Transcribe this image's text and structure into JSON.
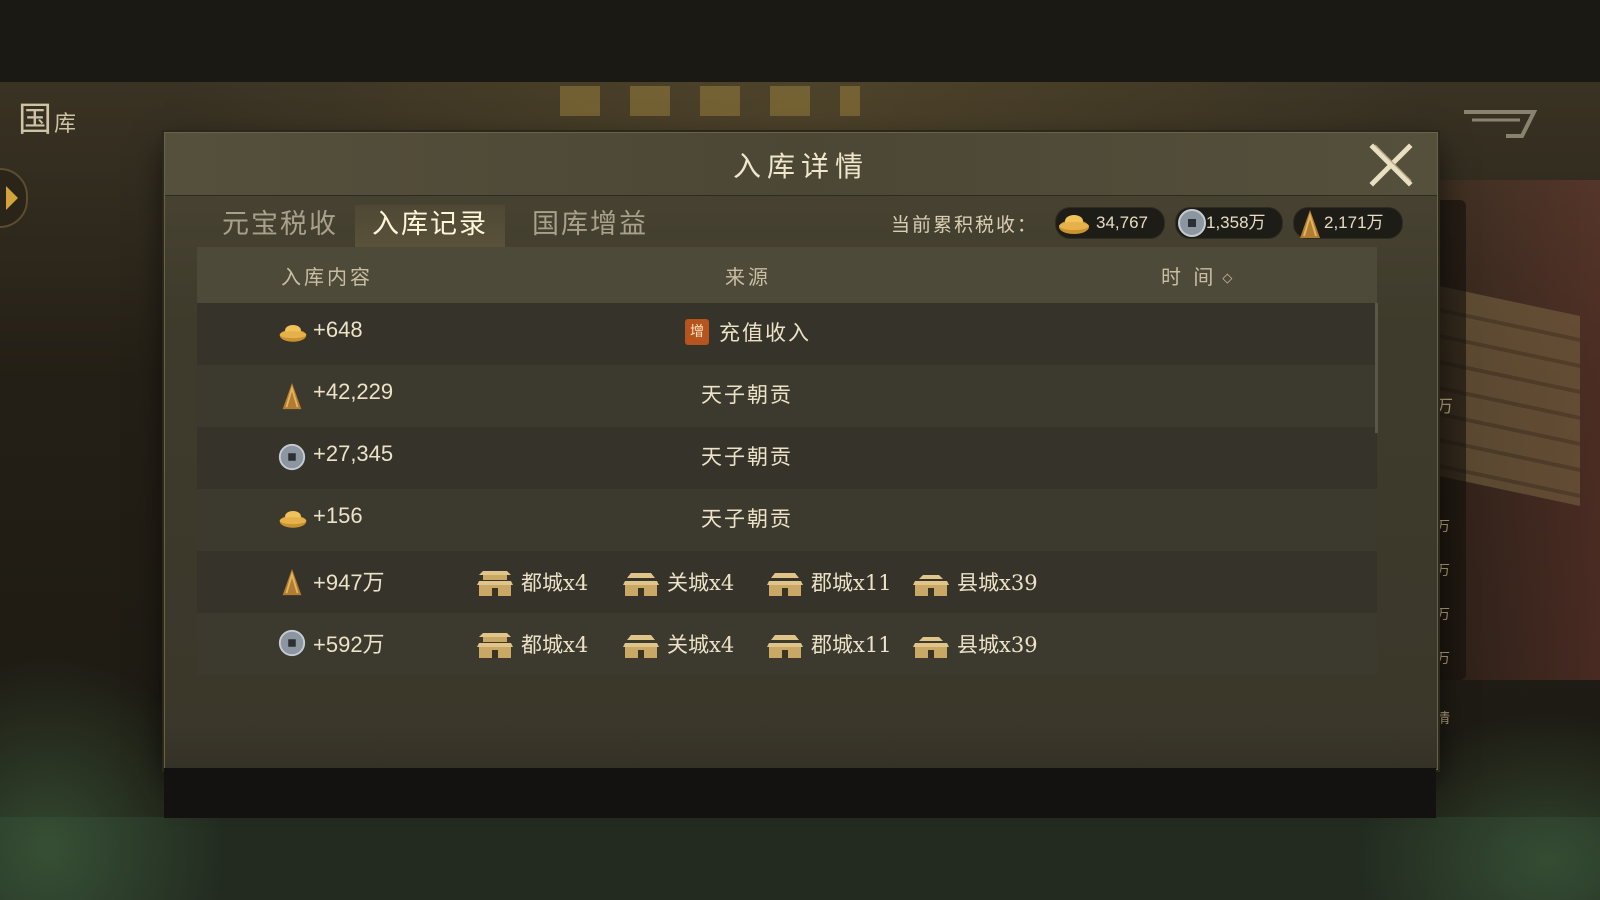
{
  "background": {
    "title_main": "国",
    "title_small": "库",
    "right_side_values": [
      "万",
      "万",
      "万",
      "万",
      "万"
    ],
    "right_side_footer": "情"
  },
  "dialog": {
    "title": "入库详情",
    "tabs": [
      {
        "label": "元宝税收",
        "active": false
      },
      {
        "label": "入库记录",
        "active": true
      },
      {
        "label": "国库增益",
        "active": false
      }
    ],
    "accumulated": {
      "label": "当前累积税收：",
      "gold_ingot": "34,767",
      "copper_coin": "1,358万",
      "grain": "2,171万"
    },
    "columns": {
      "content": "入库内容",
      "source": "来源",
      "time": "时 间"
    },
    "rows": [
      {
        "resource": "gold-ingot",
        "amount": "+648",
        "source": "充值收入",
        "tag": "增"
      },
      {
        "resource": "grain",
        "amount": "+42,229",
        "source": "天子朝贡"
      },
      {
        "resource": "copper-coin",
        "amount": "+27,345",
        "source": "天子朝贡"
      },
      {
        "resource": "gold-ingot",
        "amount": "+156",
        "source": "天子朝贡"
      },
      {
        "resource": "grain",
        "amount": "+947万",
        "cities": [
          "都城x4",
          "关城x4",
          "郡城x11",
          "县城x39"
        ]
      },
      {
        "resource": "copper-coin",
        "amount": "+592万",
        "cities": [
          "都城x4",
          "关城x4",
          "郡城x11",
          "县城x39"
        ]
      }
    ]
  },
  "colors": {
    "accent_gold": "#c49a4a",
    "tag_orange": "#b5541f"
  }
}
